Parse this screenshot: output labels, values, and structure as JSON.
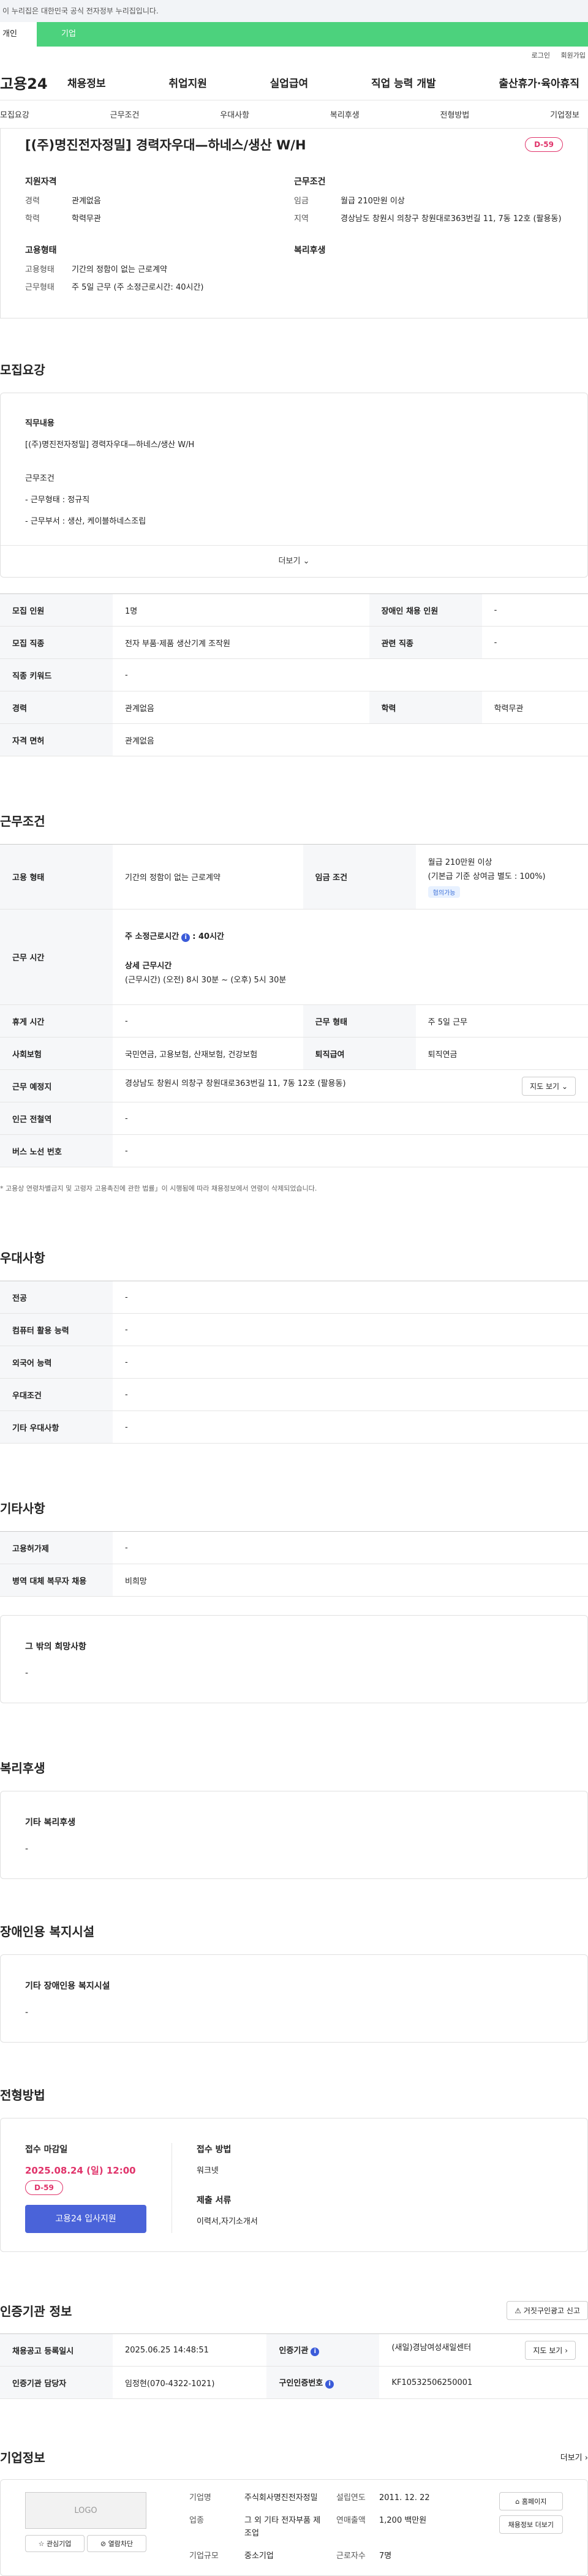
{
  "banner": "이 누리집은 대한민국 공식 전자정부 누리집입니다.",
  "top_tabs": [
    "개인",
    "기업"
  ],
  "util_links": [
    "로그인",
    "회원가입"
  ],
  "logo": "고용24",
  "gnb": [
    "채용정보",
    "취업지원",
    "실업급여",
    "직업 능력 개발",
    "출산휴가·육아휴직"
  ],
  "subnav": [
    "모집요강",
    "근무조건",
    "우대사항",
    "복리후생",
    "전형방법",
    "기업정보"
  ],
  "job": {
    "title": "[(주)명진전자정밀] 경력자우대—하네스/생산 W/H",
    "dday": "D-59",
    "qual_title": "지원자격",
    "qual": [
      {
        "k": "경력",
        "v": "관계없음"
      },
      {
        "k": "학력",
        "v": "학력무관"
      }
    ],
    "cond_title": "근무조건",
    "cond": [
      {
        "k": "임금",
        "v": "월급 210만원 이상"
      },
      {
        "k": "지역",
        "v": "경상남도 창원시 의창구 창원대로363번길 11, 7동 12호 (팔용동)"
      }
    ],
    "emp_title": "고용형태",
    "emp": [
      {
        "k": "고용형태",
        "v": "기간의 정함이 없는 근로계약"
      },
      {
        "k": "근무형태",
        "v": "주 5일 근무 (주 소정근로시간: 40시간)"
      }
    ],
    "welfare_title": "복리후생"
  },
  "recruit": {
    "title": "모집요강",
    "duty_title": "직무내용",
    "duty": "[(주)명진전자정밀] 경력자우대—하네스/생산  W/H",
    "cond_label": "근무조건",
    "lines": [
      "- 근무형태 : 정규직",
      "- 근무부서 : 생산, 케이블하네스조립"
    ],
    "more": "더보기",
    "rows": [
      [
        "모집 인원",
        "1명",
        "장애인 채용 인원",
        "-"
      ],
      [
        "모집 직종",
        "전자 부품·제품 생산기계 조작원",
        "관련 직종",
        "-"
      ],
      [
        "직종 키워드",
        "-"
      ],
      [
        "경력",
        "관계없음",
        "학력",
        "학력무관"
      ],
      [
        "자격 면허",
        "관계없음"
      ]
    ]
  },
  "work": {
    "title": "근무조건",
    "emp_type_label": "고용 형태",
    "emp_type": "기간의 정함이 없는 근로계약",
    "wage_label": "임금 조건",
    "wage1": "월급 210만원 이상",
    "wage2": "(기본급 기준 상여금 별도 : 100%)",
    "wage_badge": "협의가능",
    "hours_label": "근무 시간",
    "hours_main": "주 소정근로시간",
    "hours_val": "40시간",
    "hours_detail_title": "상세 근무시간",
    "hours_detail": "(근무시간) (오전) 8시 30분 ~ (오후) 5시 30분",
    "rest_label": "휴게 시간",
    "rest": "-",
    "type_label": "근무 형태",
    "type": "주 5일 근무",
    "ins_label": "사회보험",
    "ins": "국민연금, 고용보험, 산재보험, 건강보험",
    "sev_label": "퇴직급여",
    "sev": "퇴직연금",
    "place_label": "근무 예정지",
    "place": "경상남도 창원시 의창구 창원대로363번길 11, 7동 12호 (팔용동)",
    "map_btn": "지도 보기",
    "sub_label": "인근 전철역",
    "sub": "-",
    "bus_label": "버스 노선 번호",
    "bus": "-",
    "note": "* 고용상 연령차별금지 및 고령자 고용촉진에 관한 법률」이 시행됨에 따라 채용정보에서 연령이 삭제되었습니다."
  },
  "pref": {
    "title": "우대사항",
    "rows": [
      [
        "전공",
        "-"
      ],
      [
        "컴퓨터 활용 능력",
        "-"
      ],
      [
        "외국어 능력",
        "-"
      ],
      [
        "우대조건",
        "-"
      ],
      [
        "기타 우대사항",
        "-"
      ]
    ]
  },
  "etc": {
    "title": "기타사항",
    "rows": [
      [
        "고용허가제",
        "-"
      ],
      [
        "병역 대체 복무자 채용",
        "비희망"
      ]
    ],
    "box_title": "그 밖의 희망사항",
    "box_val": "-"
  },
  "welfare": {
    "title": "복리후생",
    "box_title": "기타 복리후생",
    "box_val": "-"
  },
  "disabled": {
    "title": "장애인용 복지시설",
    "box_title": "기타 장애인용 복지시설",
    "box_val": "-"
  },
  "apply": {
    "title": "전형방법",
    "deadline_label": "접수 마감일",
    "deadline": "2025.08.24 (일) 12:00",
    "dday": "D-59",
    "btn": "고용24 입사지원",
    "method_label": "접수 방법",
    "method": "워크넷",
    "docs_label": "제출 서류",
    "docs": "이력서,자기소개서"
  },
  "cert": {
    "title": "인증기관 정보",
    "report_btn": "거짓구인광고 신고",
    "rows": [
      [
        "채용공고 등록일시",
        "2025.06.25 14:48:51",
        "인증기관",
        "(새일)경남여성새일센터"
      ],
      [
        "인증기관 담당자",
        "임정현(070-4322-1021)",
        "구인인증번호",
        "KF10532506250001"
      ]
    ],
    "map_btn": "지도 보기"
  },
  "company": {
    "title": "기업정보",
    "more": "더보기",
    "logo": "LOGO",
    "fav": "관심기업",
    "block": "열람차단",
    "fields": [
      [
        "기업명",
        "주식회사명진전자정밀",
        "설립연도",
        "2011. 12. 22"
      ],
      [
        "업종",
        "그 외 기타 전자부품 제조업",
        "연매출액",
        "1,200 백만원"
      ],
      [
        "기업규모",
        "중소기업",
        "근로자수",
        "7명"
      ]
    ],
    "home_btn": "홈페이지",
    "jobs_btn": "채용정보 더보기"
  }
}
